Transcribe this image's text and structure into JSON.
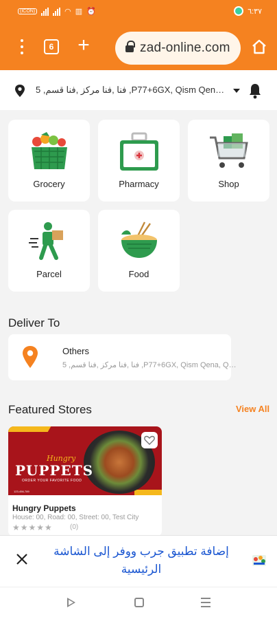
{
  "status_bar": {
    "left_text": "(ICON)",
    "right_text": "٦:٣٧"
  },
  "browser": {
    "tab_count": "6",
    "url": "zad-online.com"
  },
  "location": {
    "address": "5 ,فنا ,فنا مركز ,فنا قسم ,P77+6GX, Qism Qena, Qe..."
  },
  "categories": [
    {
      "label": "Grocery",
      "icon": "grocery-basket-icon"
    },
    {
      "label": "Pharmacy",
      "icon": "medical-kit-icon"
    },
    {
      "label": "Shop",
      "icon": "shopping-cart-icon"
    },
    {
      "label": "Parcel",
      "icon": "delivery-man-icon"
    },
    {
      "label": "Food",
      "icon": "food-bowl-icon"
    }
  ],
  "deliver_to": {
    "title": "Deliver To",
    "card_title": "Others",
    "address": "5 ,فنا ,فنا مركز ,فنا قسم ,P77+6GX, Qism Qena, Qena..."
  },
  "featured": {
    "title": "Featured Stores",
    "view_all": "View All",
    "stores": [
      {
        "banner_hungry": "Hungry",
        "banner_title": "PUPPETS",
        "banner_tag": "ORDER YOUR FAVORITE FOOD",
        "banner_phone": "123-456-789",
        "name": "Hungry Puppets",
        "address": "House: 00, Road: 00, Street: 00, Test City",
        "stars": "★★★★★",
        "rating_count": "(0)"
      }
    ]
  },
  "install_banner": {
    "message": "إضافة تطبيق جرب ووفر إلى الشاشة الرئيسية"
  },
  "colors": {
    "accent": "#f58220",
    "link": "#1a56d1"
  }
}
